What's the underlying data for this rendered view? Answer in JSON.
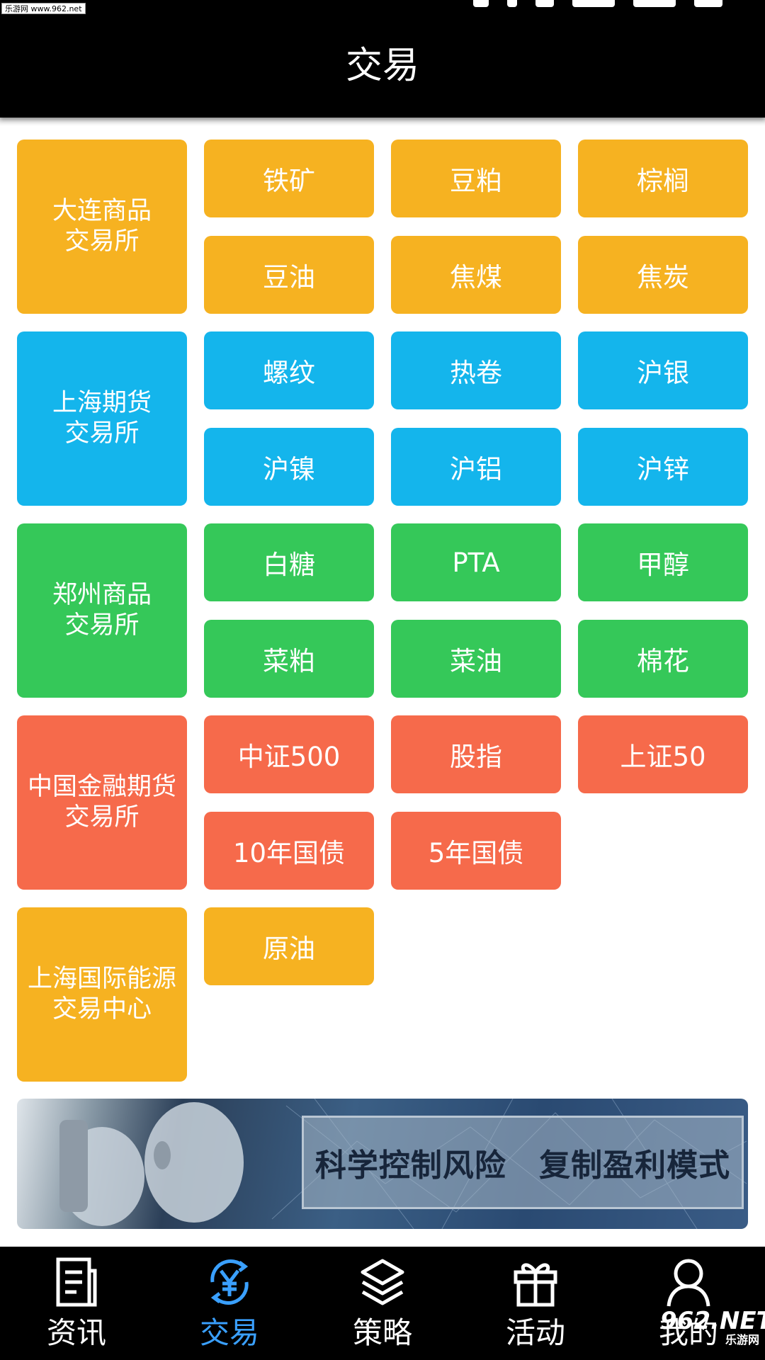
{
  "status_bar": {
    "watermark": "乐游网 www.962.net"
  },
  "header": {
    "title": "交易"
  },
  "exchanges": [
    {
      "name": "大连商品\n交易所",
      "color": "#f6b221",
      "products": [
        "铁矿",
        "豆粕",
        "棕榈",
        "豆油",
        "焦煤",
        "焦炭"
      ]
    },
    {
      "name": "上海期货\n交易所",
      "color": "#14b5ec",
      "products": [
        "螺纹",
        "热卷",
        "沪银",
        "沪镍",
        "沪铝",
        "沪锌"
      ]
    },
    {
      "name": "郑州商品\n交易所",
      "color": "#35c859",
      "products": [
        "白糖",
        "PTA",
        "甲醇",
        "菜粕",
        "菜油",
        "棉花"
      ]
    },
    {
      "name": "中国金融期货\n交易所",
      "color": "#f66a4b",
      "products": [
        "中证500",
        "股指",
        "上证50",
        "10年国债",
        "5年国债"
      ]
    },
    {
      "name": "上海国际能源\n交易中心",
      "color": "#f6b221",
      "products": [
        "原油"
      ]
    }
  ],
  "banner": {
    "text": "科学控制风险 复制盈利模式"
  },
  "bottom_nav": {
    "active_color": "#3aa0ff",
    "items": [
      {
        "label": "资讯",
        "icon": "document-icon",
        "active": false
      },
      {
        "label": "交易",
        "icon": "yen-exchange-icon",
        "active": true
      },
      {
        "label": "策略",
        "icon": "layers-icon",
        "active": false
      },
      {
        "label": "活动",
        "icon": "gift-icon",
        "active": false
      },
      {
        "label": "我的",
        "icon": "user-icon",
        "active": false
      }
    ]
  },
  "watermark_bottom": {
    "brand": "962.NET",
    "sub": "乐游网"
  }
}
